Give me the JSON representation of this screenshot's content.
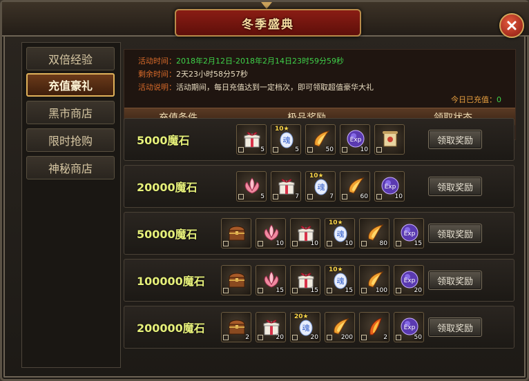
{
  "window": {
    "title": "冬季盛典"
  },
  "sidebar": {
    "items": [
      {
        "label": "双倍经验",
        "active": false
      },
      {
        "label": "充值豪礼",
        "active": true
      },
      {
        "label": "黑市商店",
        "active": false
      },
      {
        "label": "限时抢购",
        "active": false
      },
      {
        "label": "神秘商店",
        "active": false
      }
    ]
  },
  "info": {
    "time_label": "活动时间：",
    "time_value": "2018年2月12日-2018年2月14日23时59分59秒",
    "remain_label": "剩余时间：",
    "remain_value": "2天23小时58分57秒",
    "desc_label": "活动说明：",
    "desc_value": "活动期间，每日充值达到一定档次，即可领取超值豪华大礼",
    "today_label": "今日已充值：",
    "today_value": "0"
  },
  "table": {
    "headers": {
      "condition": "充值条件",
      "reward": "极品奖励",
      "status": "领取状态"
    },
    "rows": [
      {
        "amount": "5000魔石",
        "button": "领取奖励",
        "items": [
          {
            "icon": "gift-box-icon",
            "count": "5"
          },
          {
            "icon": "soul-gem-icon",
            "count": "5",
            "star": "10★"
          },
          {
            "icon": "flame-horn-icon",
            "count": "50"
          },
          {
            "icon": "exp-orb-icon",
            "count": "10"
          },
          {
            "icon": "scroll-icon",
            "count": ""
          }
        ]
      },
      {
        "amount": "20000魔石",
        "button": "领取奖励",
        "items": [
          {
            "icon": "lotus-icon",
            "count": "5"
          },
          {
            "icon": "gift-box-icon",
            "count": "7"
          },
          {
            "icon": "soul-gem-icon",
            "count": "7",
            "star": "10★"
          },
          {
            "icon": "flame-horn-icon",
            "count": "60"
          },
          {
            "icon": "exp-orb-icon",
            "count": "10"
          }
        ]
      },
      {
        "amount": "50000魔石",
        "button": "领取奖励",
        "items": [
          {
            "icon": "treasure-chest-icon",
            "count": ""
          },
          {
            "icon": "lotus-icon",
            "count": "10"
          },
          {
            "icon": "gift-box-icon",
            "count": "10"
          },
          {
            "icon": "soul-gem-icon",
            "count": "10",
            "star": "10★"
          },
          {
            "icon": "flame-horn-icon",
            "count": "80"
          },
          {
            "icon": "exp-orb-icon",
            "count": "15"
          }
        ]
      },
      {
        "amount": "100000魔石",
        "button": "领取奖励",
        "items": [
          {
            "icon": "treasure-chest-icon",
            "count": ""
          },
          {
            "icon": "lotus-icon",
            "count": "15"
          },
          {
            "icon": "gift-box-icon",
            "count": "15"
          },
          {
            "icon": "soul-gem-icon",
            "count": "15",
            "star": "10★"
          },
          {
            "icon": "flame-horn-icon",
            "count": "100"
          },
          {
            "icon": "exp-orb-icon",
            "count": "20"
          }
        ]
      },
      {
        "amount": "200000魔石",
        "button": "领取奖励",
        "items": [
          {
            "icon": "treasure-chest-icon",
            "count": "2"
          },
          {
            "icon": "gift-box-icon",
            "count": "20"
          },
          {
            "icon": "soul-gem-icon",
            "count": "20",
            "star": "20★"
          },
          {
            "icon": "flame-horn-icon",
            "count": "200"
          },
          {
            "icon": "fire-feather-icon",
            "count": "2"
          },
          {
            "icon": "exp-orb-icon",
            "count": "50"
          }
        ]
      }
    ]
  },
  "colors": {
    "accent": "#e0b25a",
    "green": "#3fd24a",
    "orange": "#d86a2a",
    "amount": "#e6f07a"
  }
}
